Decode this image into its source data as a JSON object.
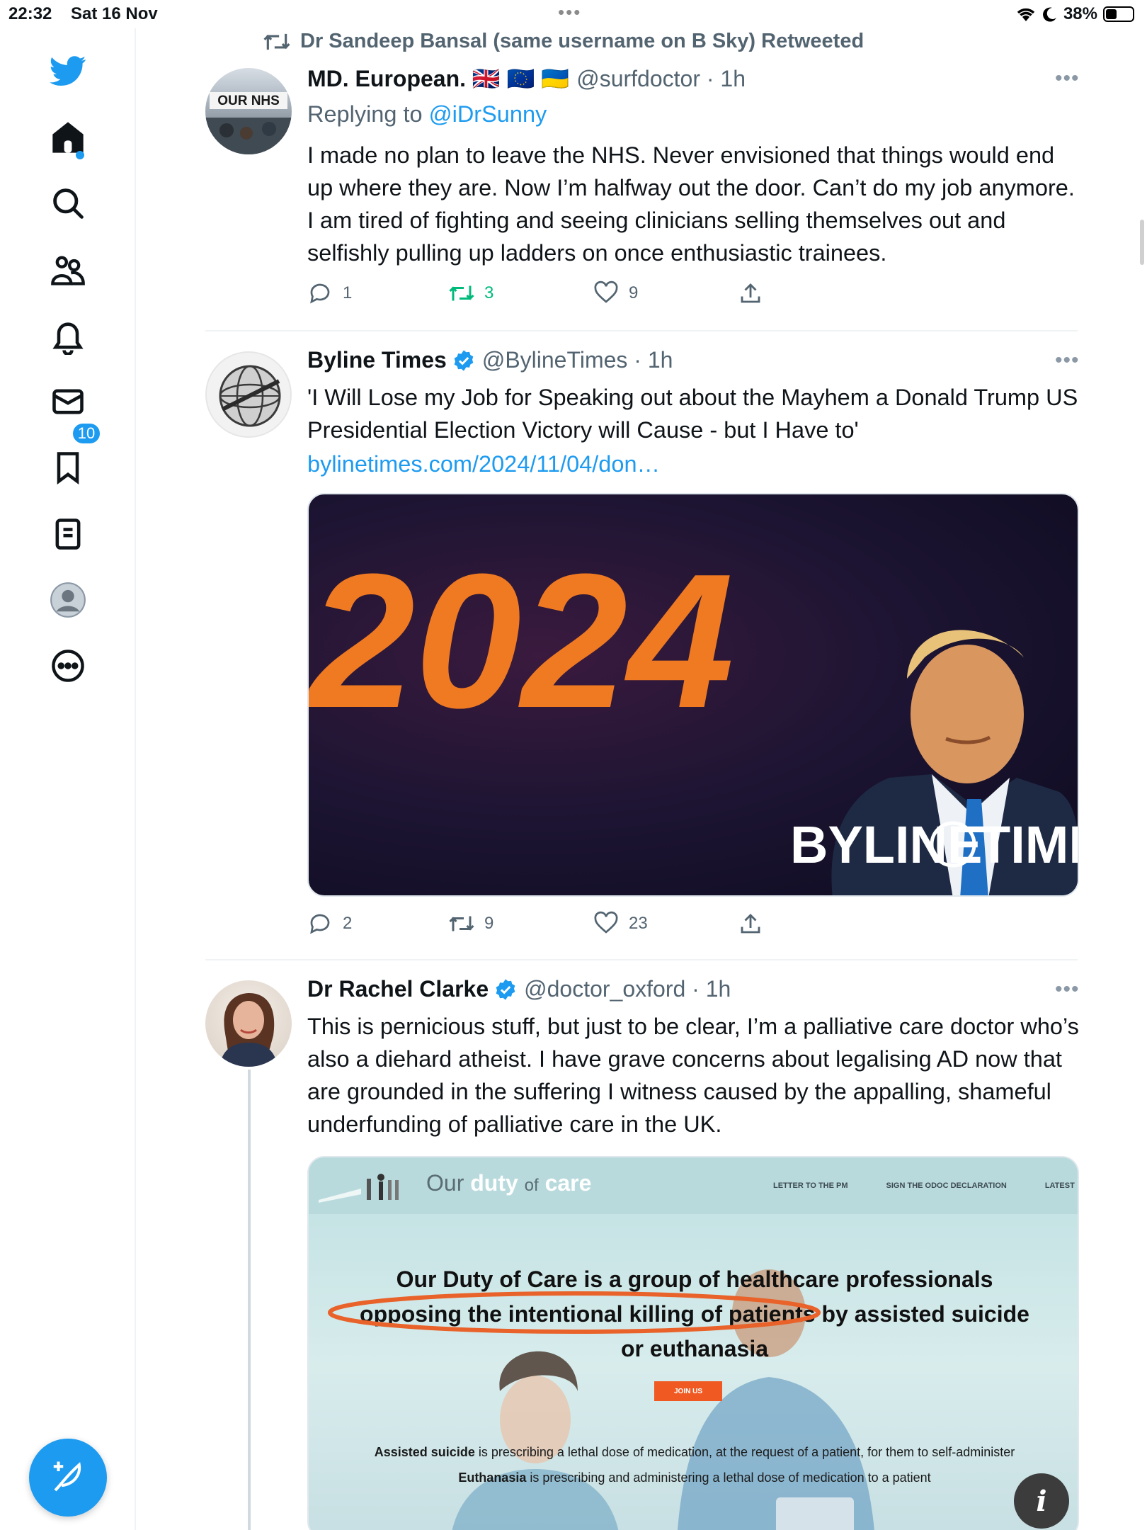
{
  "status": {
    "time": "22:32",
    "date": "Sat 16 Nov",
    "battery": "38%",
    "battery_level": 0.38
  },
  "sidebar": {
    "notifications_count": "10"
  },
  "retweet_banner": "Dr Sandeep Bansal (same username on B Sky) Retweeted",
  "tweets": [
    {
      "name": "MD. European. 🇬🇧 🇪🇺 🇺🇦",
      "handle": "@surfdoctor · 1h",
      "reply_prefix": "Replying to ",
      "reply_to": "@iDrSunny",
      "text": "I made no plan to leave the NHS. Never envisioned that things would end up where they are. Now I’m halfway out the door. Can’t do my job anymore. I am tired of fighting and seeing clinicians selling themselves out and selfishly pulling up ladders on once enthusiastic trainees.",
      "avatar_text": "OUR NHS",
      "replies": "1",
      "retweets": "3",
      "likes": "9"
    },
    {
      "name": "Byline Times",
      "handle": "@BylineTimes · 1h",
      "text": "'I Will Lose my Job for Speaking out about the Mayhem a Donald Trump US Presidential Election Victory will Cause - but I Have to'",
      "link": "bylinetimes.com/2024/11/04/don…",
      "media_year": "2024",
      "media_brand_left": "BYLINE",
      "media_brand_right": "TIMES",
      "replies": "2",
      "retweets": "9",
      "likes": "23"
    },
    {
      "name": "Dr Rachel Clarke",
      "handle": "@doctor_oxford · 1h",
      "text": "This is pernicious stuff, but just to be clear, I’m a palliative care doctor who’s also a diehard atheist. I have grave concerns about legalising AD now that are grounded in the suffering I witness caused by the appalling, shameful underfunding of palliative care in the UK.",
      "media": {
        "logo_our": "Our",
        "logo_duty": "duty",
        "logo_of": "of",
        "logo_care": "care",
        "nav": [
          "LETTER TO THE PM",
          "SIGN THE ODOC DECLARATION",
          "LATEST"
        ],
        "headline_1": "Our Duty of Care is a group of healthcare professionals",
        "headline_2": "opposing the intentional killing of patients by assisted suicide",
        "headline_3": "or euthanasia",
        "join_button": "JOIN US",
        "def1_term": "Assisted suicide",
        "def1_text": " is prescribing a lethal dose of medication, at the request of a patient, for them to self-administer",
        "def2_term": "Euthanasia",
        "def2_text": " is prescribing and administering a lethal dose of medication to a patient",
        "info_glyph": "i"
      }
    }
  ],
  "colors": {
    "accent": "#1d9bf0",
    "retweet_green": "#00ba7c",
    "secondary_text": "#536471"
  }
}
